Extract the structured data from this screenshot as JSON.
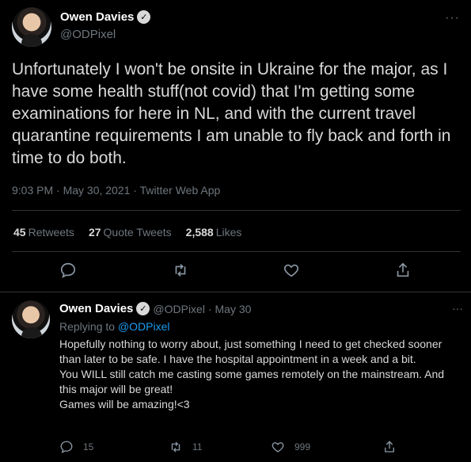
{
  "main_tweet": {
    "author": {
      "name": "Owen Davies",
      "handle": "@ODPixel"
    },
    "text": "Unfortunately I won't be onsite in Ukraine for the major, as I have some health stuff(not covid) that I'm getting some examinations for here in NL, and with the current travel quarantine requirements I am unable to fly back and forth in time to do both.",
    "meta": "9:03 PM · May 30, 2021 · Twitter Web App",
    "stats": {
      "retweets_count": "45",
      "retweets_label": "Retweets",
      "quotes_count": "27",
      "quotes_label": "Quote Tweets",
      "likes_count": "2,588",
      "likes_label": "Likes"
    },
    "icons": [
      "reply-icon",
      "retweet-icon",
      "like-icon",
      "share-icon"
    ]
  },
  "reply_tweet": {
    "author": {
      "name": "Owen Davies",
      "handle": "@ODPixel",
      "date": "· May 30"
    },
    "replying_prefix": "Replying to",
    "replying_to": "@ODPixel",
    "text": "Hopefully nothing to worry about, just something I need to get checked sooner than later to be safe. I have the hospital appointment in a week and a bit.\nYou WILL still catch me casting some games remotely on the mainstream. And this major will be great!\nGames will be amazing!<3",
    "counts": {
      "replies": "15",
      "retweets": "11",
      "likes": "999"
    }
  },
  "colors": {
    "background": "#000000",
    "text": "#d9d9d9",
    "muted": "#6e767d",
    "link": "#1d9bf0",
    "divider": "#2f3336"
  }
}
